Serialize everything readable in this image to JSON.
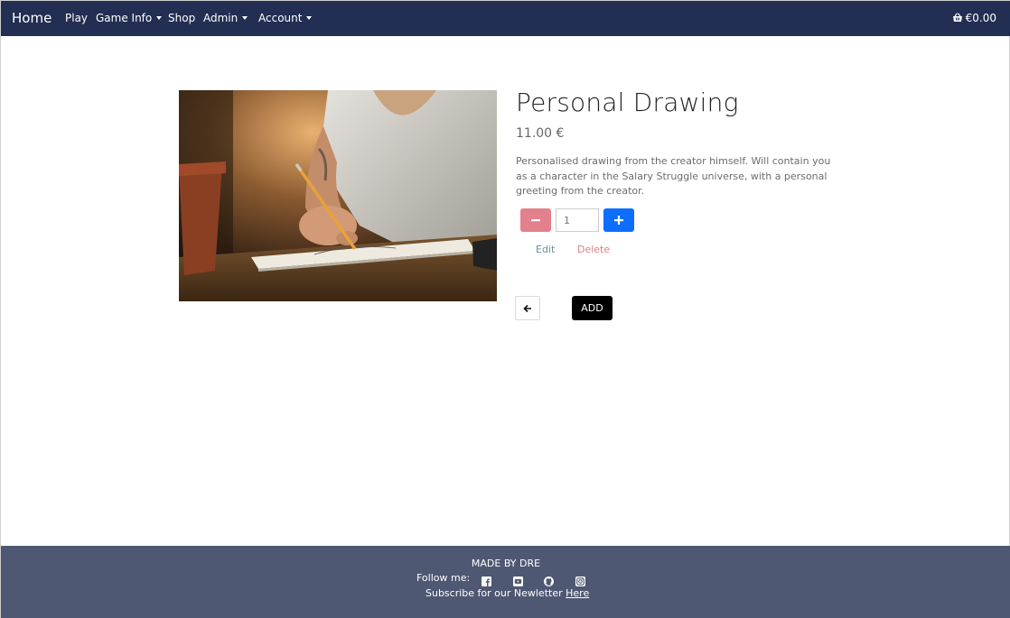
{
  "navbar": {
    "brand": "Home",
    "items": [
      {
        "label": "Play",
        "dropdown": false
      },
      {
        "label": "Game Info",
        "dropdown": true
      },
      {
        "label": "Shop",
        "dropdown": false
      },
      {
        "label": "Admin",
        "dropdown": true
      },
      {
        "label": "Account",
        "dropdown": true
      }
    ],
    "cart": {
      "icon": "basket-icon",
      "total": "€0.00"
    },
    "background_color": "#222e52"
  },
  "product": {
    "image_alt": "Hand drawing with a pencil on paper",
    "title": "Personal Drawing",
    "price": "11.00 €",
    "description": "Personalised drawing from the creator himself. Will contain you as a character in the Salary Struggle universe, with a personal greeting from the creator.",
    "quantity": {
      "value": "1",
      "decrease_icon": "minus-icon",
      "increase_icon": "plus-icon",
      "decrease_color": "#e4808b",
      "increase_color": "#0d6efd"
    },
    "edit_label": "Edit",
    "delete_label": "Delete",
    "back_icon": "arrow-left-icon",
    "add_label": "ADD"
  },
  "footer": {
    "made_by": "MADE BY DRE",
    "follow_label": "Follow me:",
    "social_icons": [
      "facebook-icon",
      "youtube-icon",
      "github-icon",
      "instagram-icon"
    ],
    "subscribe_text": "Subscribe for our Newletter",
    "subscribe_link": "Here",
    "background_color": "#4f5872"
  }
}
